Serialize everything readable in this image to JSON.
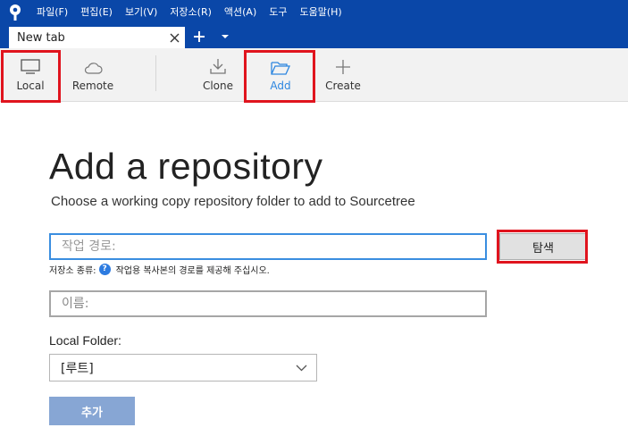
{
  "menubar": {
    "items": [
      "파일(F)",
      "편집(E)",
      "보기(V)",
      "저장소(R)",
      "액션(A)",
      "도구",
      "도움말(H)"
    ]
  },
  "tabs": {
    "active_label": "New tab"
  },
  "toolbar": {
    "local_label": "Local",
    "remote_label": "Remote",
    "clone_label": "Clone",
    "add_label": "Add",
    "create_label": "Create"
  },
  "main": {
    "title": "Add a repository",
    "subtitle": "Choose a working copy repository folder to add to Sourcetree",
    "path_placeholder": "작업 경로:",
    "browse_label": "탐색",
    "repo_type_label": "저장소 종류:",
    "repo_type_help": "?",
    "repo_type_hint": "작업용 복사본의 경로를 제공해 주십시오.",
    "name_placeholder": "이름:",
    "local_folder_label": "Local Folder:",
    "local_folder_value": "[루트]",
    "add_button": "추가"
  },
  "colors": {
    "titlebar": "#0a47a8",
    "accent": "#2d86e0",
    "highlight": "#e0141e",
    "add_button": "#87a6d4"
  },
  "icons": {
    "logo": "sourcetree-logo-icon",
    "tab_close": "close-icon",
    "new_tab": "plus-icon",
    "tab_menu": "chevron-down-icon",
    "local": "monitor-icon",
    "remote": "cloud-icon",
    "clone": "download-icon",
    "add": "folder-open-icon",
    "create": "plus-icon",
    "help": "question-icon",
    "folder_select": "chevron-down-icon"
  }
}
